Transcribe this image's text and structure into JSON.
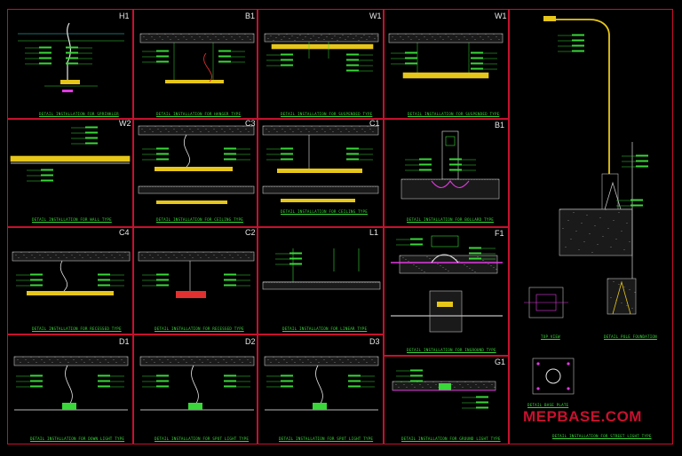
{
  "watermark": "MEPBASE.COM",
  "colors": {
    "border": "#c8102e",
    "note": "#38d838",
    "slab": "#bfbfbf",
    "conduit": "#e6c619",
    "pipe": "#3ad63a",
    "magenta": "#e03ae0",
    "cyan": "#3ad6d6"
  },
  "details": [
    {
      "id": "H1",
      "caption": "DETAIL INSTALLATION FOR SPRINKLER"
    },
    {
      "id": "B1",
      "caption": "DETAIL INSTALLATION FOR HANGER TYPE"
    },
    {
      "id": "W1",
      "caption": "DETAIL INSTALLATION FOR SUSPENDED TYPE"
    },
    {
      "id": "W1",
      "caption": "DETAIL INSTALLATION FOR SUSPENDED TYPE"
    },
    {
      "id": "W2",
      "caption": "DETAIL INSTALLATION FOR WALL TYPE"
    },
    {
      "id": "C3",
      "caption": "DETAIL INSTALLATION FOR CEILING TYPE"
    },
    {
      "id": "C1",
      "caption": "DETAIL INSTALLATION FOR CEILING TYPE"
    },
    {
      "id": "B1",
      "caption": "DETAIL INSTALLATION FOR BOLLARD TYPE"
    },
    {
      "id": "C4",
      "caption": "DETAIL INSTALLATION FOR RECESSED TYPE"
    },
    {
      "id": "C2",
      "caption": "DETAIL INSTALLATION FOR RECESSED TYPE"
    },
    {
      "id": "L1",
      "caption": "DETAIL INSTALLATION FOR LINEAR TYPE"
    },
    {
      "id": "F1",
      "caption": "DETAIL INSTALLATION FOR INGROUND TYPE"
    },
    {
      "id": "D1",
      "caption": "DETAIL INSTALLATION FOR DOWN LIGHT TYPE"
    },
    {
      "id": "D2",
      "caption": "DETAIL INSTALLATION FOR SPOT LIGHT TYPE"
    },
    {
      "id": "D3",
      "caption": "DETAIL INSTALLATION FOR SPOT LIGHT TYPE"
    },
    {
      "id": "G1",
      "caption": "DETAIL INSTALLATION FOR GROUND LIGHT TYPE"
    },
    {
      "id": "",
      "caption": "DETAIL INSTALLATION FOR STREET LIGHT TYPE"
    }
  ],
  "pole_notes": {
    "top_view": "TOP VIEW",
    "foundation": "DETAIL POLE FOUNDATION",
    "base_plate": "DETAIL BASE PLATE"
  }
}
